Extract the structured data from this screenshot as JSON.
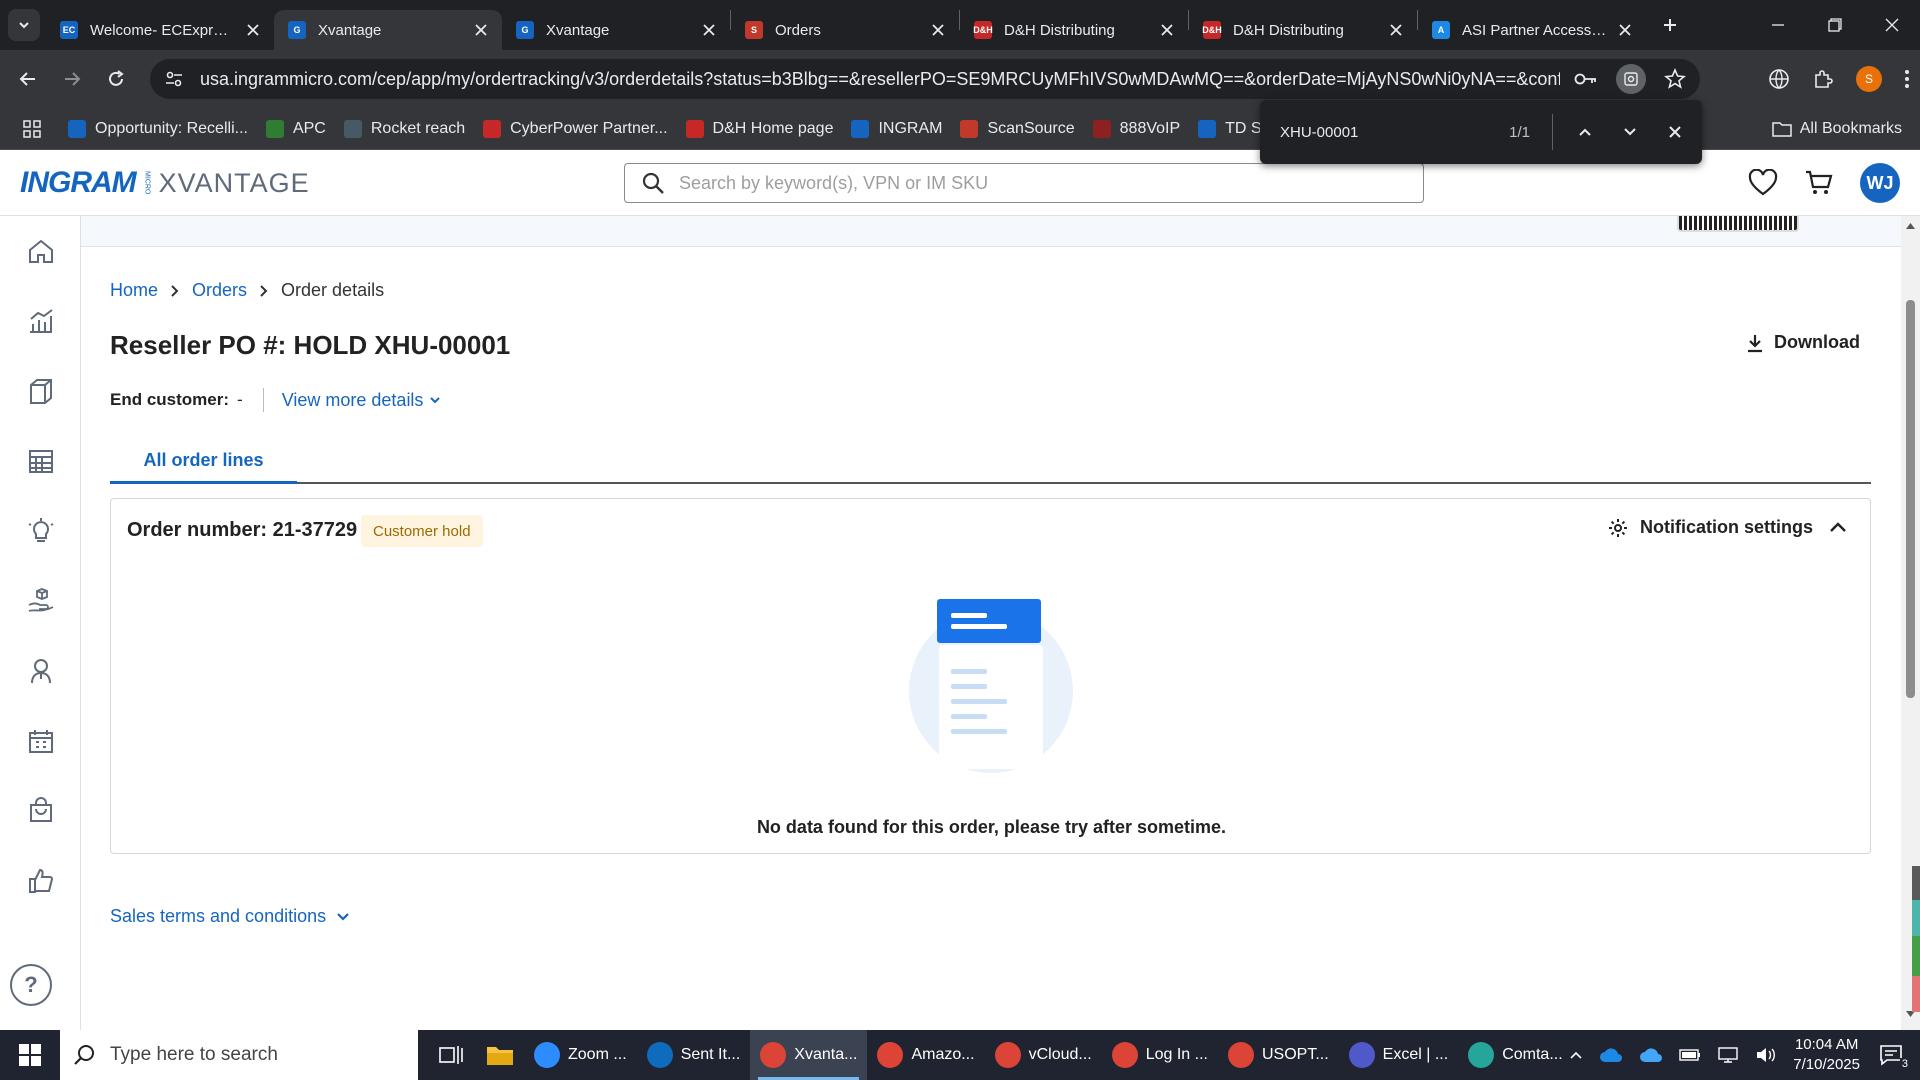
{
  "browser": {
    "tabs": [
      {
        "title": "Welcome- ECExpress",
        "favicon": "EC",
        "color": "#1565c0",
        "active": false
      },
      {
        "title": "Xvantage",
        "favicon": "G",
        "color": "#1565c0",
        "active": true
      },
      {
        "title": "Xvantage",
        "favicon": "G",
        "color": "#1565c0",
        "active": false
      },
      {
        "title": "Orders",
        "favicon": "S",
        "color": "#c0392b",
        "active": false
      },
      {
        "title": "D&H Distributing",
        "favicon": "D&H",
        "color": "#c62828",
        "active": false
      },
      {
        "title": "D&H Distributing",
        "favicon": "D&H",
        "color": "#c62828",
        "active": false
      },
      {
        "title": "ASI Partner Access - I",
        "favicon": "A",
        "color": "#1e88e5",
        "active": false
      }
    ],
    "url": "usa.ingrammicro.com/cep/app/my/ordertracking/v3/orderdetails?status=b3Blbg==&resellerPO=SE9MRCUyMFhIVS0wMDAwMQ==&orderDate=MjAyNS0wNi0yNA==&confir...",
    "profile_initial": "S",
    "bookmarks": [
      {
        "label": "Opportunity: Recelli...",
        "color": "#1565c0",
        "icon": "cloud-icon"
      },
      {
        "label": "APC",
        "color": "#2e7d32",
        "icon": "apc-icon"
      },
      {
        "label": "Rocket reach",
        "color": "#455a64",
        "icon": "rocket-icon"
      },
      {
        "label": "CyberPower Partner...",
        "color": "#c62828",
        "icon": "CP"
      },
      {
        "label": "D&H Home page",
        "color": "#c62828",
        "icon": "D&H"
      },
      {
        "label": "INGRAM",
        "color": "#1565c0",
        "icon": "G"
      },
      {
        "label": "ScanSource",
        "color": "#c0392b",
        "icon": "S"
      },
      {
        "label": "888VoIP",
        "color": "#8d2020",
        "icon": "8"
      },
      {
        "label": "TD SYNN",
        "color": "#1565c0",
        "icon": "EC"
      }
    ],
    "all_bookmarks": "All Bookmarks"
  },
  "findbar": {
    "query": "XHU-00001",
    "count": "1/1"
  },
  "app": {
    "logo_main": "INGRAM",
    "logo_micro": "MICRO",
    "logo_product": "XVANTAGE",
    "search_placeholder": "Search by keyword(s), VPN or IM SKU",
    "avatar_initials": "WJ"
  },
  "breadcrumb": [
    "Home",
    "Orders",
    "Order details"
  ],
  "page": {
    "title": "Reseller PO #: HOLD XHU-00001",
    "download_label": "Download",
    "end_customer_label": "End customer:",
    "end_customer_value": "-",
    "view_more_label": "View more details",
    "tab_label": "All order lines"
  },
  "order": {
    "number_label": "Order number: 21-37729",
    "status_badge": "Customer hold",
    "notification_label": "Notification settings",
    "empty_message": "No data found for this order, please try after sometime."
  },
  "sales_terms_label": "Sales terms and conditions",
  "taskbar": {
    "search_placeholder": "Type here to search",
    "apps": [
      {
        "label": "Zoom ...",
        "icon": "zoom",
        "color": "#2d8cff",
        "active": false
      },
      {
        "label": "Sent It...",
        "icon": "outlook",
        "color": "#0f6cbd",
        "active": false
      },
      {
        "label": "Xvanta...",
        "icon": "chrome",
        "color": "#db4437",
        "active": true
      },
      {
        "label": "Amazo...",
        "icon": "chrome",
        "color": "#db4437",
        "active": false
      },
      {
        "label": "vCloud...",
        "icon": "chrome",
        "color": "#db4437",
        "active": false
      },
      {
        "label": "Log In ...",
        "icon": "chrome",
        "color": "#db4437",
        "active": false
      },
      {
        "label": "USOPT...",
        "icon": "chrome",
        "color": "#db4437",
        "active": false
      },
      {
        "label": "Excel | ...",
        "icon": "teams",
        "color": "#5059c9",
        "active": false
      },
      {
        "label": "Comta...",
        "icon": "app",
        "color": "#26a69a",
        "active": false
      }
    ],
    "time": "10:04 AM",
    "date": "7/10/2025",
    "notification_count": "3"
  }
}
